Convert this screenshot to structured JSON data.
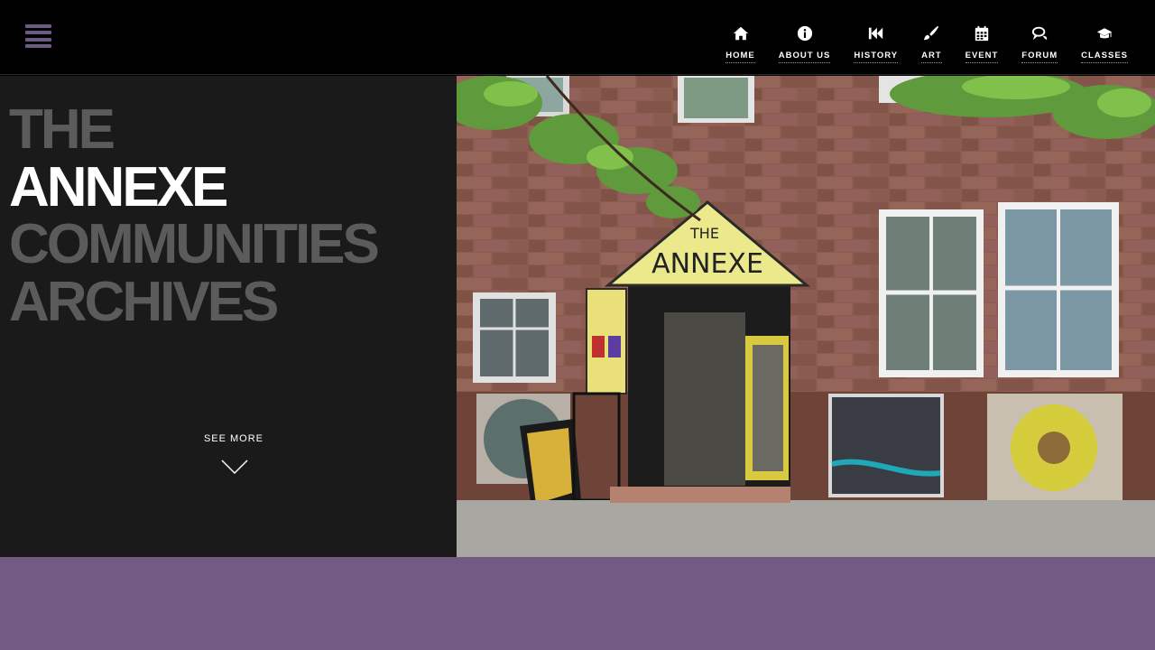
{
  "nav": {
    "items": [
      {
        "label": "HOME",
        "icon": "home-icon"
      },
      {
        "label": "ABOUT US",
        "icon": "info-icon"
      },
      {
        "label": "HISTORY",
        "icon": "rewind-icon"
      },
      {
        "label": "ART",
        "icon": "paintbrush-icon"
      },
      {
        "label": "EVENT",
        "icon": "calendar-icon"
      },
      {
        "label": "FORUM",
        "icon": "chat-icon"
      },
      {
        "label": "CLASSES",
        "icon": "graduation-cap-icon"
      }
    ]
  },
  "hero": {
    "title": [
      "THE",
      "ANNEXE",
      "COMMUNITIES",
      "ARCHIVES"
    ],
    "see_more": "SEE MORE",
    "sign_top": "THE",
    "sign_main": "ANNEXE"
  },
  "colors": {
    "accent_purple": "#735a83",
    "hamburger": "#6f5a85",
    "title_gray": "#5b5b5b",
    "panel_bg": "#1a1a1a"
  }
}
